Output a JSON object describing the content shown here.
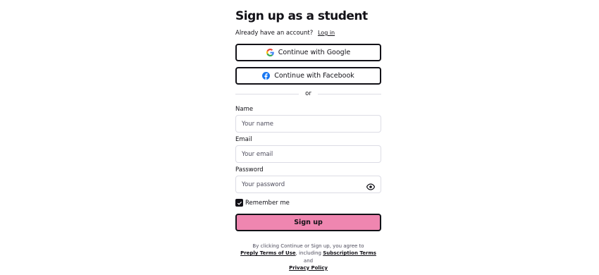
{
  "title": "Sign up as a student",
  "login_prompt": {
    "question": "Already have an account?",
    "link": "Log in"
  },
  "social": {
    "google_label": "Continue with Google",
    "facebook_label": "Continue with Facebook",
    "google_icon": "google-icon",
    "facebook_icon": "facebook-icon"
  },
  "divider_label": "or",
  "fields": {
    "name": {
      "label": "Name",
      "placeholder": "Your name",
      "value": ""
    },
    "email": {
      "label": "Email",
      "placeholder": "Your email",
      "value": ""
    },
    "password": {
      "label": "Password",
      "placeholder": "Your password",
      "value": "",
      "toggle_icon": "eye-icon"
    }
  },
  "remember": {
    "label": "Remember me",
    "checked": true
  },
  "signup_button": "Sign up",
  "terms": {
    "prefix": "By clicking Continue or Sign up, you agree to",
    "terms_link": "Preply Terms of Use",
    "middle": ", including",
    "subscription_link": "Subscription Terms",
    "and": "and",
    "privacy_link": "Privacy Policy"
  },
  "colors": {
    "accent": "#ef86b0",
    "text": "#121117",
    "border": "#dcdce5",
    "facebook": "#1877f2"
  }
}
